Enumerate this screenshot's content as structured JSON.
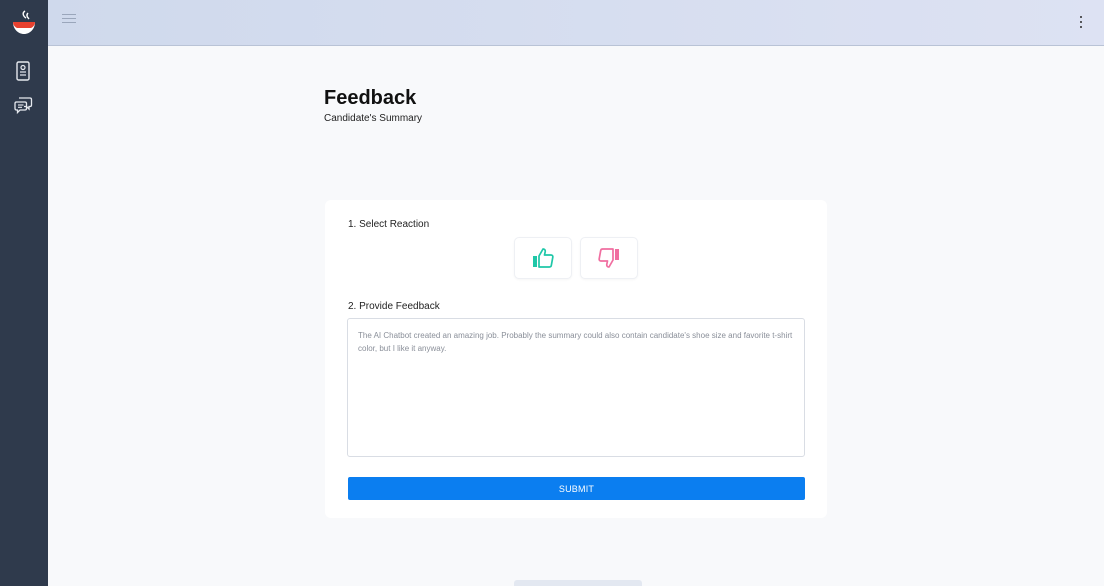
{
  "topbar": {
    "menu_icon": "hamburger-icon",
    "more_icon": "kebab-icon"
  },
  "sidebar": {
    "logo_icon": "bowl-logo-icon",
    "items": [
      {
        "icon": "candidate-card-icon"
      },
      {
        "icon": "chat-bubbles-icon"
      }
    ]
  },
  "page": {
    "title": "Feedback",
    "subtitle": "Candidate's Summary"
  },
  "form": {
    "reaction_label": "1. Select Reaction",
    "thumbs_up_icon": "thumbs-up-icon",
    "thumbs_down_icon": "thumbs-down-icon",
    "feedback_label": "2. Provide Feedback",
    "feedback_placeholder": "The AI Chatbot created an amazing job. Probably the summary could also contain candidate's shoe size and favorite t-shirt color, but I like it anyway.",
    "submit_label": "SUBMIT"
  },
  "colors": {
    "accent": "#0b7ef0",
    "thumbs_up": "#1fc7a8",
    "thumbs_down": "#f06ea0",
    "sidebar": "#2f3a4c"
  }
}
